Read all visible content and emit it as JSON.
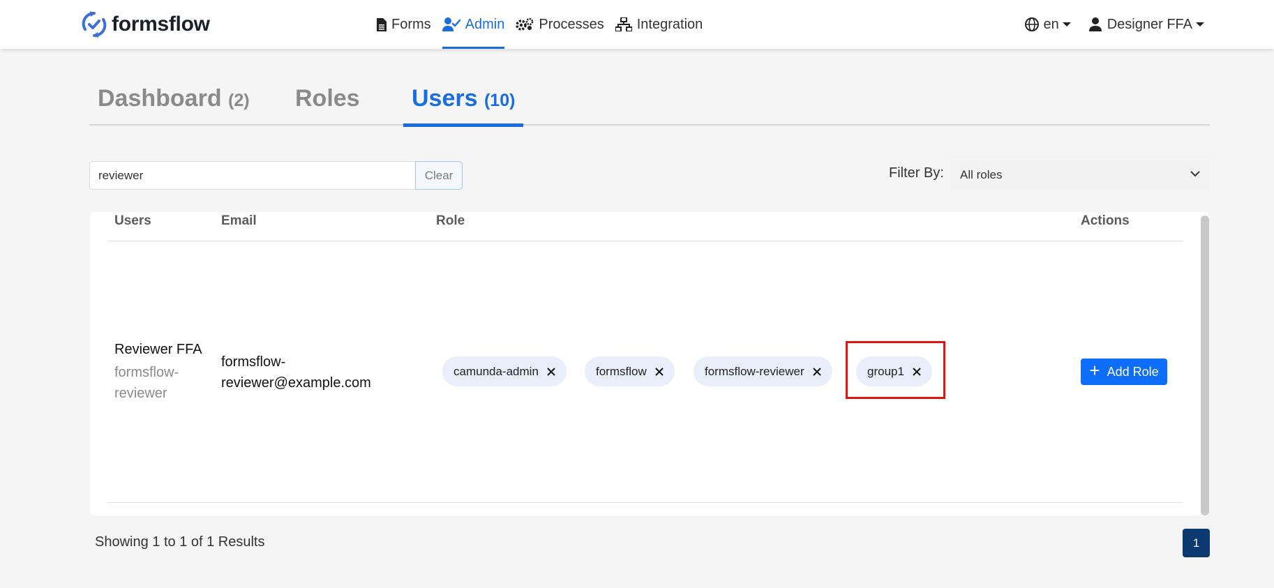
{
  "brand": {
    "name": "formsflow"
  },
  "nav": {
    "links": [
      {
        "label": "Forms",
        "icon": "file-icon"
      },
      {
        "label": "Admin",
        "icon": "user-check-icon",
        "active": true
      },
      {
        "label": "Processes",
        "icon": "gears-icon"
      },
      {
        "label": "Integration",
        "icon": "network-icon"
      }
    ],
    "language": "en",
    "user": "Designer FFA",
    "accent_color": "#1a6de0"
  },
  "tabs": [
    {
      "label": "Dashboard",
      "count": "(2)"
    },
    {
      "label": "Roles",
      "count": ""
    },
    {
      "label": "Users",
      "count": "(10)",
      "active": true
    }
  ],
  "search": {
    "value": "reviewer",
    "clear_label": "Clear"
  },
  "filter": {
    "label": "Filter By:",
    "selected": "All roles"
  },
  "table": {
    "headers": [
      "Users",
      "Email",
      "Role",
      "Actions"
    ],
    "rows": [
      {
        "name": "Reviewer FFA",
        "username": "formsflow-reviewer",
        "email": "formsflow-reviewer@example.com",
        "roles": [
          "camunda-admin",
          "formsflow",
          "formsflow-reviewer",
          "group1"
        ],
        "action_label": "Add Role"
      }
    ]
  },
  "pagination": {
    "summary": "Showing 1 to 1 of 1 Results",
    "current_page": "1"
  }
}
